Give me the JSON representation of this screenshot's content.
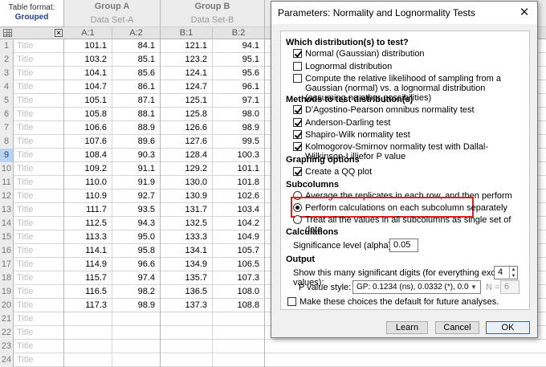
{
  "sheet": {
    "table_format_label": "Table format:",
    "table_format_value": "Grouped",
    "groups": [
      {
        "name": "Group A",
        "dataset": "Data Set-A",
        "subcols": [
          "A:1",
          "A:2"
        ]
      },
      {
        "name": "Group B",
        "dataset": "Data Set-B",
        "subcols": [
          "B:1",
          "B:2"
        ]
      }
    ],
    "title_placeholder": "Title",
    "selected_row": 9,
    "rows": [
      {
        "n": "1",
        "a1": "101.1",
        "a2": "84.1",
        "b1": "121.1",
        "b2": "94.1"
      },
      {
        "n": "2",
        "a1": "103.2",
        "a2": "85.1",
        "b1": "123.2",
        "b2": "95.1"
      },
      {
        "n": "3",
        "a1": "104.1",
        "a2": "85.6",
        "b1": "124.1",
        "b2": "95.6"
      },
      {
        "n": "4",
        "a1": "104.7",
        "a2": "86.1",
        "b1": "124.7",
        "b2": "96.1"
      },
      {
        "n": "5",
        "a1": "105.1",
        "a2": "87.1",
        "b1": "125.1",
        "b2": "97.1"
      },
      {
        "n": "6",
        "a1": "105.8",
        "a2": "88.1",
        "b1": "125.8",
        "b2": "98.0"
      },
      {
        "n": "7",
        "a1": "106.6",
        "a2": "88.9",
        "b1": "126.6",
        "b2": "98.9"
      },
      {
        "n": "8",
        "a1": "107.6",
        "a2": "89.6",
        "b1": "127.6",
        "b2": "99.5"
      },
      {
        "n": "9",
        "a1": "108.4",
        "a2": "90.3",
        "b1": "128.4",
        "b2": "100.3"
      },
      {
        "n": "10",
        "a1": "109.2",
        "a2": "91.1",
        "b1": "129.2",
        "b2": "101.1"
      },
      {
        "n": "11",
        "a1": "110.0",
        "a2": "91.9",
        "b1": "130.0",
        "b2": "101.8"
      },
      {
        "n": "12",
        "a1": "110.9",
        "a2": "92.7",
        "b1": "130.9",
        "b2": "102.6"
      },
      {
        "n": "13",
        "a1": "111.7",
        "a2": "93.5",
        "b1": "131.7",
        "b2": "103.4"
      },
      {
        "n": "14",
        "a1": "112.5",
        "a2": "94.3",
        "b1": "132.5",
        "b2": "104.2"
      },
      {
        "n": "15",
        "a1": "113.3",
        "a2": "95.0",
        "b1": "133.3",
        "b2": "104.9"
      },
      {
        "n": "16",
        "a1": "114.1",
        "a2": "95.8",
        "b1": "134.1",
        "b2": "105.7"
      },
      {
        "n": "17",
        "a1": "114.9",
        "a2": "96.6",
        "b1": "134.9",
        "b2": "106.5"
      },
      {
        "n": "18",
        "a1": "115.7",
        "a2": "97.4",
        "b1": "135.7",
        "b2": "107.3"
      },
      {
        "n": "19",
        "a1": "116.5",
        "a2": "98.2",
        "b1": "136.5",
        "b2": "108.0"
      },
      {
        "n": "20",
        "a1": "117.3",
        "a2": "98.9",
        "b1": "137.3",
        "b2": "108.8"
      },
      {
        "n": "21",
        "a1": "",
        "a2": "",
        "b1": "",
        "b2": ""
      },
      {
        "n": "22",
        "a1": "",
        "a2": "",
        "b1": "",
        "b2": ""
      },
      {
        "n": "23",
        "a1": "",
        "a2": "",
        "b1": "",
        "b2": ""
      },
      {
        "n": "24",
        "a1": "",
        "a2": "",
        "b1": "",
        "b2": ""
      }
    ]
  },
  "dialog": {
    "title": "Parameters: Normality and Lognormality Tests",
    "close_glyph": "✕",
    "sections": {
      "distribution": "Which distribution(s) to test?",
      "methods": "Methods to test distribution(s)",
      "graphing": "Graphing options",
      "subcolumns": "Subcolumns",
      "calculations": "Calculations",
      "output": "Output"
    },
    "distribution_options": [
      {
        "label": "Normal (Gaussian) distribution",
        "checked": true
      },
      {
        "label": "Lognormal distribution",
        "checked": false
      },
      {
        "label": "Compute the relative likelihood of sampling from a Gaussian (normal) vs. a lognormal distribution (assuming no other possibilities)",
        "checked": false
      }
    ],
    "method_options": [
      {
        "label": "D'Agostino-Pearson omnibus normality test",
        "checked": true
      },
      {
        "label": "Anderson-Darling test",
        "checked": true
      },
      {
        "label": "Shapiro-Wilk normality test",
        "checked": true
      },
      {
        "label": "Kolmogorov-Smirnov normality test with Dallal-Wilkinson-Lilliefor P value",
        "checked": true
      }
    ],
    "graphing_option": {
      "label": "Create a QQ plot",
      "checked": true
    },
    "subcolumn_options": [
      {
        "label": "Average the replicates in each row, and then perform the calculation for each column",
        "selected": false
      },
      {
        "label": "Perform calculations on each subcolumn separately",
        "selected": true
      },
      {
        "label": "Treat all the values in all subcolumns as single set of data",
        "selected": false
      }
    ],
    "significance_label": "Significance level (alpha)",
    "significance_value": "0.05",
    "sig_digits_label": "Show this many significant digits (for everything except P values):",
    "sig_digits_value": "4",
    "pvalue_style_label": "P value style:",
    "pvalue_style_value": "GP: 0.1234 (ns), 0.0332 (*), 0.0021 (**),",
    "n_label": "N =",
    "n_value": "6",
    "default_option": {
      "label": "Make these choices the default for future analyses.",
      "checked": false
    },
    "buttons": {
      "learn": "Learn",
      "cancel": "Cancel",
      "ok": "OK"
    },
    "highlight_color": "#e02020"
  }
}
